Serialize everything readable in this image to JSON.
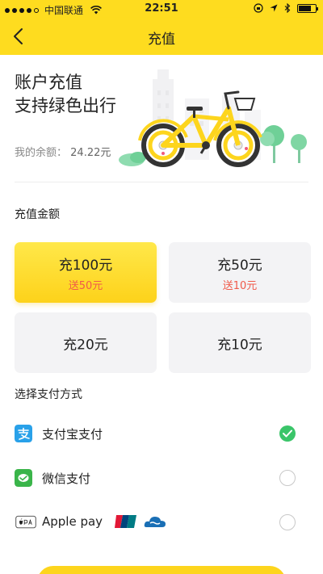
{
  "status_bar": {
    "carrier": "中国联通",
    "time": "22:51"
  },
  "nav": {
    "title": "充值"
  },
  "hero": {
    "line1": "账户充值",
    "line2": "支持绿色出行",
    "balance_label": "我的余额：",
    "balance_value": "24.22元"
  },
  "amount_section": {
    "label": "充值金额",
    "options": [
      {
        "amount": "充100元",
        "bonus": "送50元",
        "selected": true
      },
      {
        "amount": "充50元",
        "bonus": "送10元",
        "selected": false
      },
      {
        "amount": "充20元",
        "bonus": "",
        "selected": false
      },
      {
        "amount": "充10元",
        "bonus": "",
        "selected": false
      }
    ]
  },
  "payment_section": {
    "label": "选择支付方式",
    "methods": [
      {
        "name": "支付宝支付",
        "icon": "alipay-icon",
        "selected": true
      },
      {
        "name": "微信支付",
        "icon": "wechat-pay-icon",
        "selected": false
      },
      {
        "name": "Apple pay",
        "icon": "apple-pay-icon",
        "selected": false
      }
    ]
  },
  "colors": {
    "brand_yellow": "#fedc1f",
    "bonus_red": "#f05a4a",
    "check_green": "#3ac569",
    "alipay_blue": "#29a1e9",
    "wechat_green": "#3ab54a"
  }
}
